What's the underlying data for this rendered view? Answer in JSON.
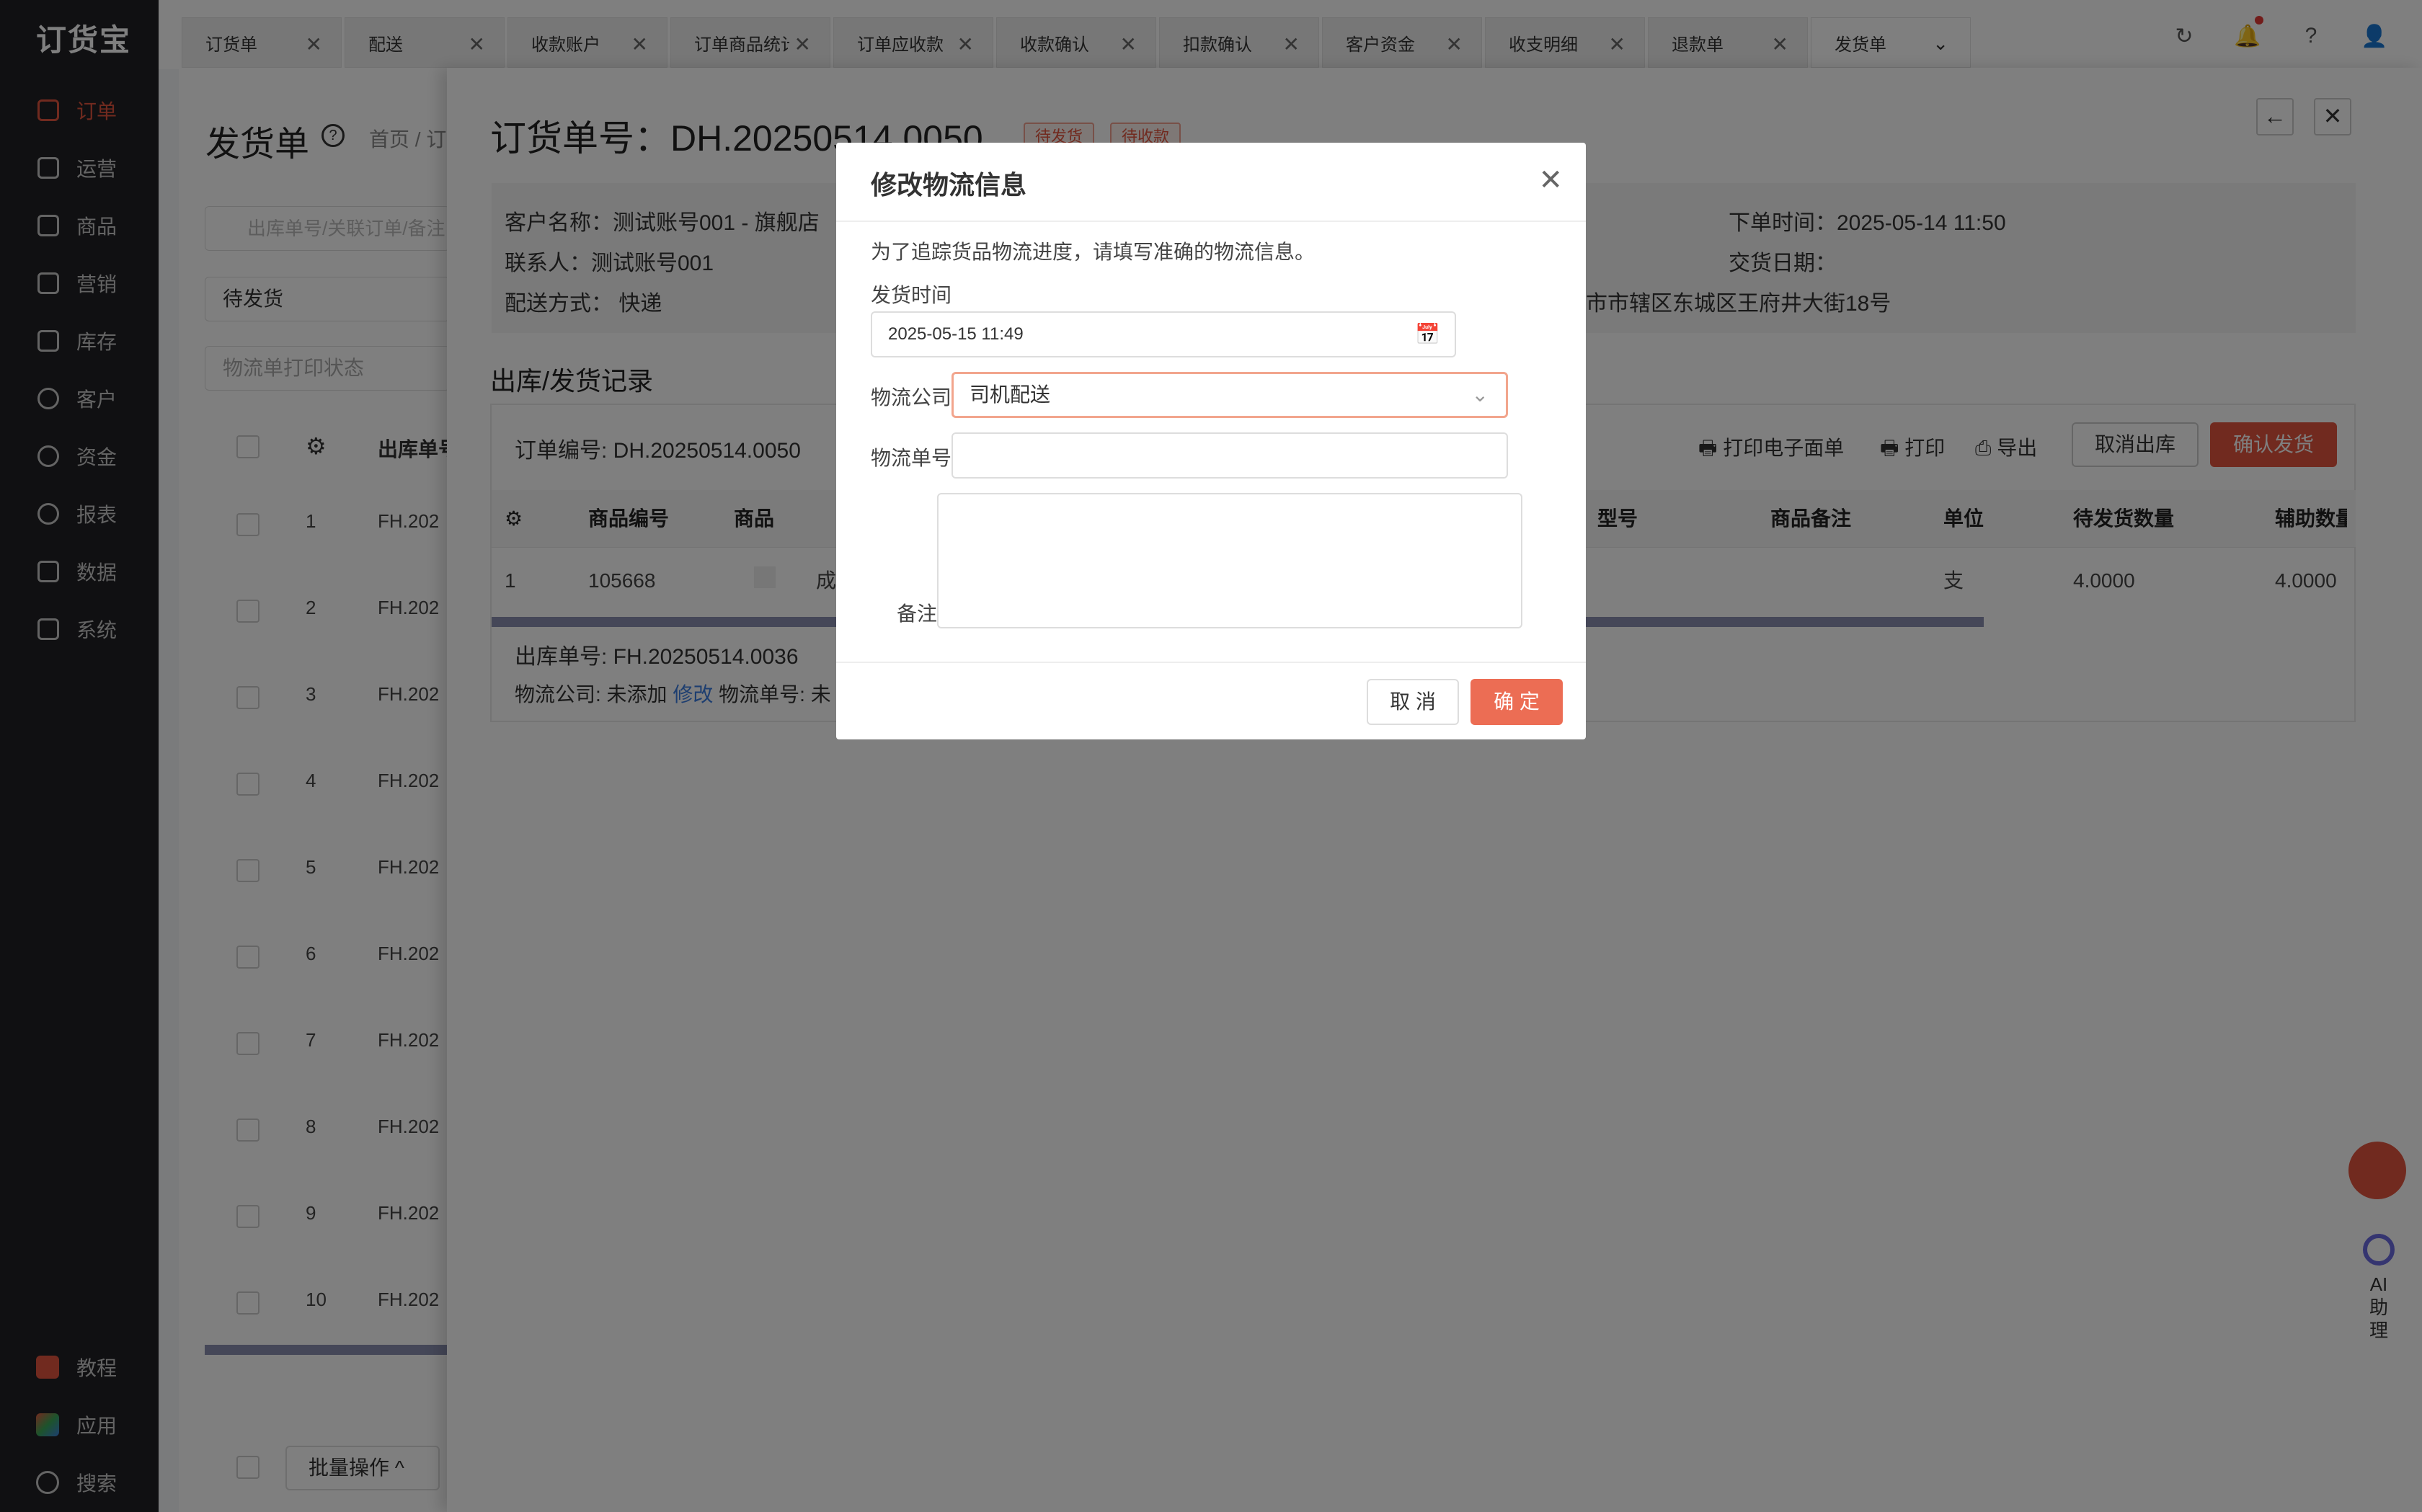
{
  "app": {
    "logo": "订货宝"
  },
  "sidebar": {
    "items": [
      {
        "label": "订单",
        "icon": "order-icon"
      },
      {
        "label": "运营",
        "icon": "operations-icon"
      },
      {
        "label": "商品",
        "icon": "products-icon"
      },
      {
        "label": "营销",
        "icon": "marketing-icon"
      },
      {
        "label": "库存",
        "icon": "warehouse-icon"
      },
      {
        "label": "客户",
        "icon": "customer-icon"
      },
      {
        "label": "资金",
        "icon": "funds-icon"
      },
      {
        "label": "报表",
        "icon": "report-icon"
      },
      {
        "label": "数据",
        "icon": "data-icon"
      },
      {
        "label": "系统",
        "icon": "system-icon"
      }
    ],
    "bottom": [
      {
        "label": "教程",
        "icon": "tutorial-icon"
      },
      {
        "label": "应用",
        "icon": "apps-icon"
      },
      {
        "label": "搜索",
        "icon": "search-icon"
      }
    ],
    "accent": "#e2553e"
  },
  "tabs": [
    "订货单",
    "配送",
    "收款账户",
    "订单商品统计",
    "订单应收款",
    "收款确认",
    "扣款确认",
    "客户资金",
    "收支明细",
    "退款单",
    "发货单"
  ],
  "background_page": {
    "title": "发货单",
    "breadcrumb": "首页 / 订",
    "search_placeholder": "出库单号/关联订单/备注",
    "status_select": "待发货",
    "print_select": "物流单打印状态",
    "col_header": "出库单号",
    "rows": [
      {
        "n": "1",
        "id": "FH.202"
      },
      {
        "n": "2",
        "id": "FH.202"
      },
      {
        "n": "3",
        "id": "FH.202"
      },
      {
        "n": "4",
        "id": "FH.202"
      },
      {
        "n": "5",
        "id": "FH.202"
      },
      {
        "n": "6",
        "id": "FH.202"
      },
      {
        "n": "7",
        "id": "FH.202"
      },
      {
        "n": "8",
        "id": "FH.202"
      },
      {
        "n": "9",
        "id": "FH.202"
      },
      {
        "n": "10",
        "id": "FH.202"
      }
    ],
    "batch_label": "批量操作"
  },
  "detail_panel": {
    "title": "订货单号：DH.20250514.0050",
    "badges": [
      "待发货",
      "待收款"
    ],
    "info": {
      "customer": "客户名称：测试账号001 - 旗舰店",
      "contact": "联系人：测试账号001",
      "delivery": "配送方式：  快递",
      "order_time": "下单时间：2025-05-14 11:50",
      "deliver_date": "交货日期：",
      "address": "市市辖区东城区王府井大街18号"
    },
    "section_title": "出库/发货记录",
    "order_no": "订单编号: DH.20250514.0050",
    "actions": {
      "print_e": "打印电子面单",
      "print": "打印",
      "export": "导出",
      "cancel_out": "取消出库",
      "confirm": "确认发货"
    },
    "headers": [
      "商品编号",
      "商品",
      "型号",
      "商品备注",
      "单位",
      "待发货数量",
      "辅助数量"
    ],
    "row": {
      "n": "1",
      "code": "105668",
      "name": "成",
      "unit": "支",
      "qty": "4.0000",
      "aux": "4.0000"
    },
    "outbound_no": "出库单号: FH.20250514.0036",
    "logistics_co": "物流公司: 未添加",
    "edit_link": "修改",
    "logistics_no": "物流单号: 未"
  },
  "modal": {
    "title": "修改物流信息",
    "hint": "为了追踪货品物流进度，请填写准确的物流信息。",
    "ship_time_label": "发货时间",
    "ship_time_value": "2025-05-15 11:49",
    "company_label": "物流公司",
    "company_value": "司机配送",
    "tracking_label": "物流单号",
    "tracking_value": "",
    "remark_label": "备注",
    "remark_value": "",
    "cancel": "取 消",
    "ok": "确 定"
  },
  "floating": {
    "ai_label": "AI\n助\n理"
  }
}
